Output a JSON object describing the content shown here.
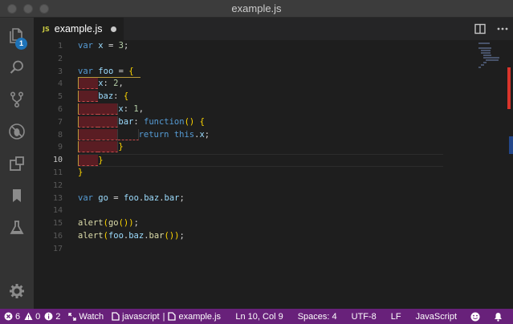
{
  "window": {
    "title": "example.js"
  },
  "activity_bar": {
    "items": [
      {
        "name": "explorer",
        "badge": "1"
      },
      {
        "name": "search"
      },
      {
        "name": "source-control"
      },
      {
        "name": "debug"
      },
      {
        "name": "extensions"
      },
      {
        "name": "bookmarks"
      },
      {
        "name": "testing"
      }
    ],
    "settings": "gear"
  },
  "tabs": [
    {
      "lang_icon": "JS",
      "label": "example.js",
      "dirty": true
    }
  ],
  "editor": {
    "active_line": 10,
    "line_numbers": [
      "1",
      "2",
      "3",
      "4",
      "5",
      "6",
      "7",
      "8",
      "9",
      "10",
      "11",
      "12",
      "13",
      "14",
      "15",
      "16",
      "17"
    ],
    "lines": [
      "var x = 3;",
      "",
      "var foo = {",
      "    x: 2,",
      "    baz: {",
      "        x: 1,",
      "        bar: function() {",
      "            return this.x;",
      "        }",
      "    }",
      "}",
      "",
      "var go = foo.baz.bar;",
      "",
      "alert(go());",
      "alert(foo.baz.bar());",
      ""
    ]
  },
  "colors": {
    "status_bar": "#68217a",
    "keyword": "#569cd6",
    "variable": "#9cdcfe",
    "number": "#b5cea8",
    "function": "#dcdcaa",
    "bracket": "#ffd700",
    "error_scroll": "#d9342b"
  },
  "status_bar": {
    "errors": "6",
    "warnings": "0",
    "infos": "2",
    "watch": "Watch",
    "breadcrumb_lang": "javascript",
    "breadcrumb_sep": "|",
    "breadcrumb_file": "example.js",
    "position": "Ln 10, Col 9",
    "spaces": "Spaces: 4",
    "encoding": "UTF-8",
    "eol": "LF",
    "language": "JavaScript"
  }
}
